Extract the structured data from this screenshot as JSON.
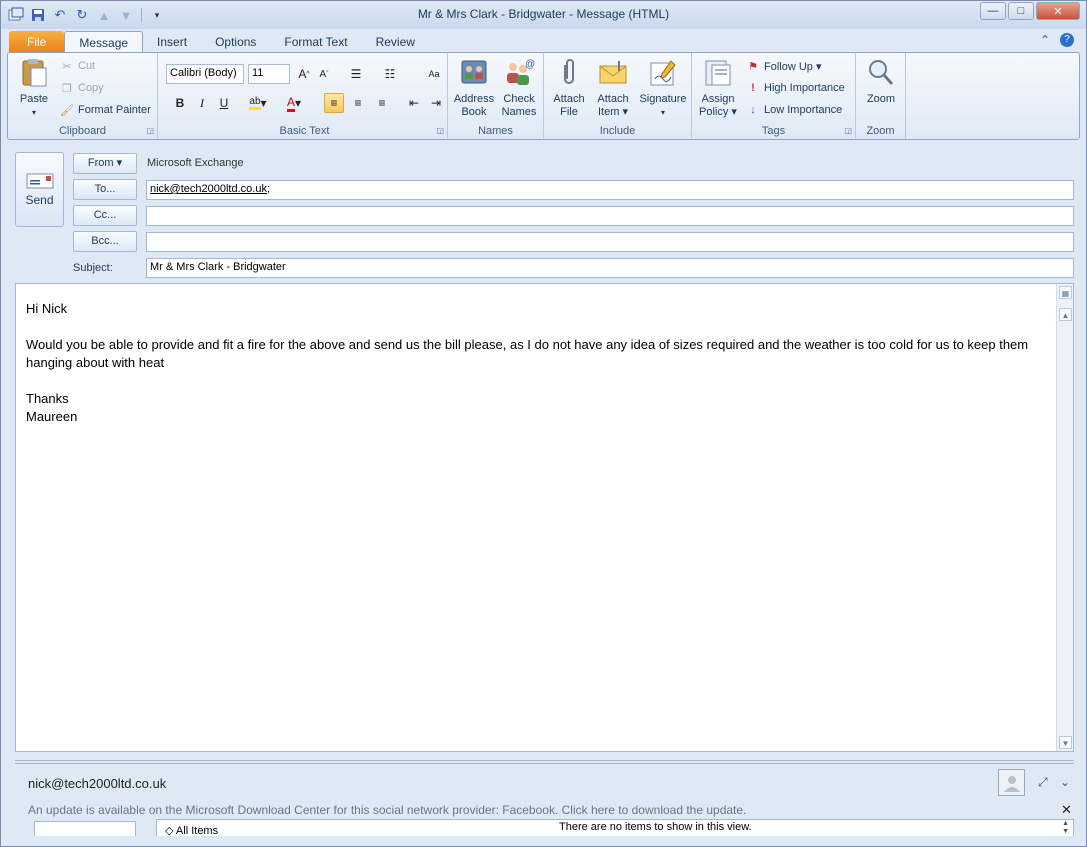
{
  "window": {
    "title": "Mr & Mrs Clark - Bridgwater  -  Message (HTML)",
    "minimize": "—",
    "maximize": "□",
    "close": "✕"
  },
  "qat": {
    "save_icon": "save-icon",
    "undo_icon": "undo-icon",
    "redo_icon": "redo-icon"
  },
  "tabs": [
    {
      "label": "File"
    },
    {
      "label": "Message"
    },
    {
      "label": "Insert"
    },
    {
      "label": "Options"
    },
    {
      "label": "Format Text"
    },
    {
      "label": "Review"
    }
  ],
  "ribbon": {
    "clipboard": {
      "label": "Clipboard",
      "paste": "Paste",
      "cut": "Cut",
      "copy": "Copy",
      "format_painter": "Format Painter"
    },
    "basic_text": {
      "label": "Basic Text",
      "font": "Calibri (Body)",
      "size": "11",
      "bold": "B",
      "italic": "I",
      "underline": "U"
    },
    "names": {
      "label": "Names",
      "address_book_1": "Address",
      "address_book_2": "Book",
      "check_names_1": "Check",
      "check_names_2": "Names"
    },
    "include": {
      "label": "Include",
      "attach_file_1": "Attach",
      "attach_file_2": "File",
      "attach_item_1": "Attach",
      "attach_item_2": "Item ▾",
      "signature_1": "Signature",
      "signature_2": "▾"
    },
    "tags": {
      "label": "Tags",
      "assign_policy_1": "Assign",
      "assign_policy_2": "Policy ▾",
      "follow_up": "Follow Up ▾",
      "high_importance": "High Importance",
      "low_importance": "Low Importance"
    },
    "zoom": {
      "label": "Zoom",
      "zoom": "Zoom"
    }
  },
  "compose": {
    "send": "Send",
    "from_btn": "From ▾",
    "from_value": "Microsoft Exchange",
    "to_btn": "To...",
    "to_value": "nick@tech2000ltd.co.uk",
    "to_suffix": ";",
    "cc_btn": "Cc...",
    "cc_value": "",
    "bcc_btn": "Bcc...",
    "bcc_value": "",
    "subject_label": "Subject:",
    "subject_value": "Mr & Mrs Clark - Bridgwater"
  },
  "body": {
    "greeting": "Hi Nick",
    "paragraph": "Would you be able to provide and fit a fire for the above and send us the bill please, as I do not have any idea of sizes required and the weather is too cold for us to keep them hanging about with heat",
    "closing": "Thanks",
    "signature": "Maureen"
  },
  "people_pane": {
    "email": "nick@tech2000ltd.co.uk",
    "update_notice": "An update is available on the Microsoft Download Center for this social network provider: Facebook. Click here to download the update.",
    "all_items": "All Items",
    "no_items": "There are no items to show in this view."
  },
  "colors": {
    "file_tab": "#e9801c",
    "ribbon_bg": "#dfe9f5",
    "accent": "#2a5ca8"
  }
}
